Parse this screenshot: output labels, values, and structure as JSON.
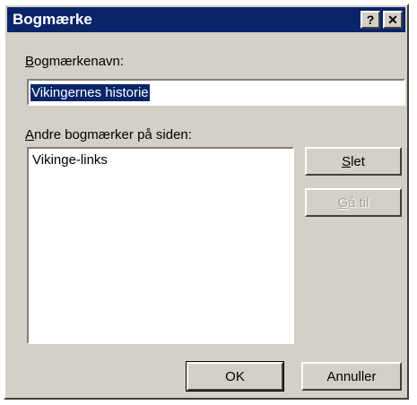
{
  "window": {
    "title": "Bogmærke",
    "help_glyph": "?",
    "close_glyph": "✕"
  },
  "name_field": {
    "label": "Bogmærkenavn:",
    "value": "Vikingernes historie"
  },
  "other_bookmarks": {
    "label": "Andre bogmærker på siden:",
    "items": [
      "Vikinge-links"
    ]
  },
  "buttons": {
    "delete": "Slet",
    "goto": "Gå til",
    "ok": "OK",
    "cancel": "Annuller"
  },
  "colors": {
    "titlebar": "#0a246a",
    "face": "#d4d0c8",
    "selection": "#0a246a"
  }
}
